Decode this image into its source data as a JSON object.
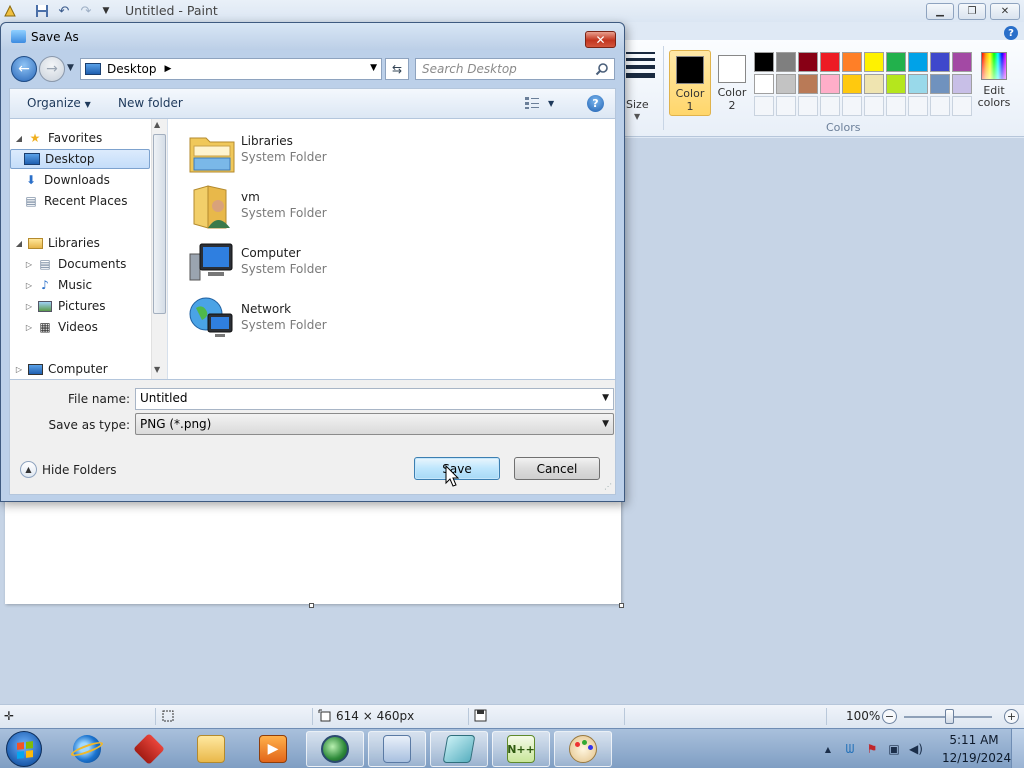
{
  "paint": {
    "title": "Untitled - Paint",
    "help": "?",
    "ribbon": {
      "size_label": "Size",
      "color1_label": "Color",
      "color1_num": "1",
      "color2_label": "Color",
      "color2_num": "2",
      "colors_group_label": "Colors",
      "edit_colors_line1": "Edit",
      "edit_colors_line2": "colors",
      "color1_value": "#000000",
      "color2_value": "#ffffff",
      "palette_row1": [
        "#000000",
        "#7f7f7f",
        "#880015",
        "#ed1c24",
        "#ff7f27",
        "#fff200",
        "#22b14c",
        "#00a2e8",
        "#3f48cc",
        "#a349a4"
      ],
      "palette_row2": [
        "#ffffff",
        "#c3c3c3",
        "#b97a57",
        "#ffaec9",
        "#ffc90e",
        "#efe4b0",
        "#b5e61d",
        "#99d9ea",
        "#7092be",
        "#c8bfe7"
      ]
    },
    "status": {
      "canvas_size": "614 × 460px",
      "zoom": "100%",
      "zoom_out": "−",
      "zoom_in": "+"
    }
  },
  "dialog": {
    "title": "Save As",
    "address": "Desktop",
    "search_placeholder": "Search Desktop",
    "toolbar": {
      "organize": "Organize",
      "new_folder": "New folder"
    },
    "nav_items": [
      {
        "label": "Favorites"
      },
      {
        "label": "Desktop"
      },
      {
        "label": "Downloads"
      },
      {
        "label": "Recent Places"
      },
      {
        "label": "Libraries"
      },
      {
        "label": "Documents"
      },
      {
        "label": "Music"
      },
      {
        "label": "Pictures"
      },
      {
        "label": "Videos"
      },
      {
        "label": "Computer"
      }
    ],
    "files": [
      {
        "name": "Libraries",
        "type": "System Folder"
      },
      {
        "name": "vm",
        "type": "System Folder"
      },
      {
        "name": "Computer",
        "type": "System Folder"
      },
      {
        "name": "Network",
        "type": "System Folder"
      }
    ],
    "file_name_label": "File name:",
    "file_name_value": "Untitled",
    "save_type_label": "Save as type:",
    "save_type_value": "PNG (*.png)",
    "hide_folders": "Hide Folders",
    "save_button": "Save",
    "cancel_button": "Cancel"
  },
  "taskbar": {
    "time": "5:11 AM",
    "date": "12/19/2024"
  }
}
